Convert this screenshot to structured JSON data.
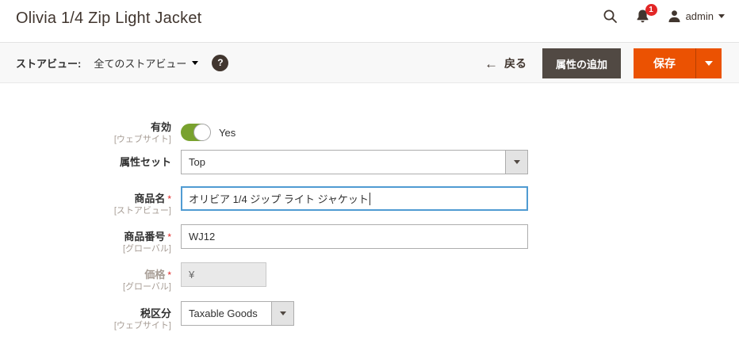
{
  "header": {
    "title": "Olivia 1/4 Zip Light Jacket",
    "notifications_badge": "1",
    "username": "admin"
  },
  "toolbar": {
    "store_view_label": "ストアビュー:",
    "store_view_value": "全てのストアビュー",
    "help_glyph": "?",
    "back_arrow": "←",
    "back_label": "戻る",
    "add_attribute_label": "属性の追加",
    "save_label": "保存"
  },
  "form": {
    "enable": {
      "label": "有効",
      "scope": "[ウェブサイト]",
      "value": "Yes"
    },
    "attribute_set": {
      "label": "属性セット",
      "value": "Top"
    },
    "product_name": {
      "label": "商品名",
      "scope": "[ストアビュー]",
      "required": "*",
      "value": "オリビア 1/4 ジップ ライト ジャケット"
    },
    "sku": {
      "label": "商品番号",
      "scope": "[グローバル]",
      "required": "*",
      "value": "WJ12"
    },
    "price": {
      "label": "価格",
      "scope": "[グローバル]",
      "required": "*",
      "value": "¥"
    },
    "tax_class": {
      "label": "税区分",
      "scope": "[ウェブサイト]",
      "value": "Taxable Goods"
    }
  },
  "colors": {
    "accent_orange": "#eb5202",
    "dark_button": "#514943",
    "toggle_green": "#79a22e",
    "focus_blue": "#509bd2",
    "badge_red": "#e22626"
  }
}
